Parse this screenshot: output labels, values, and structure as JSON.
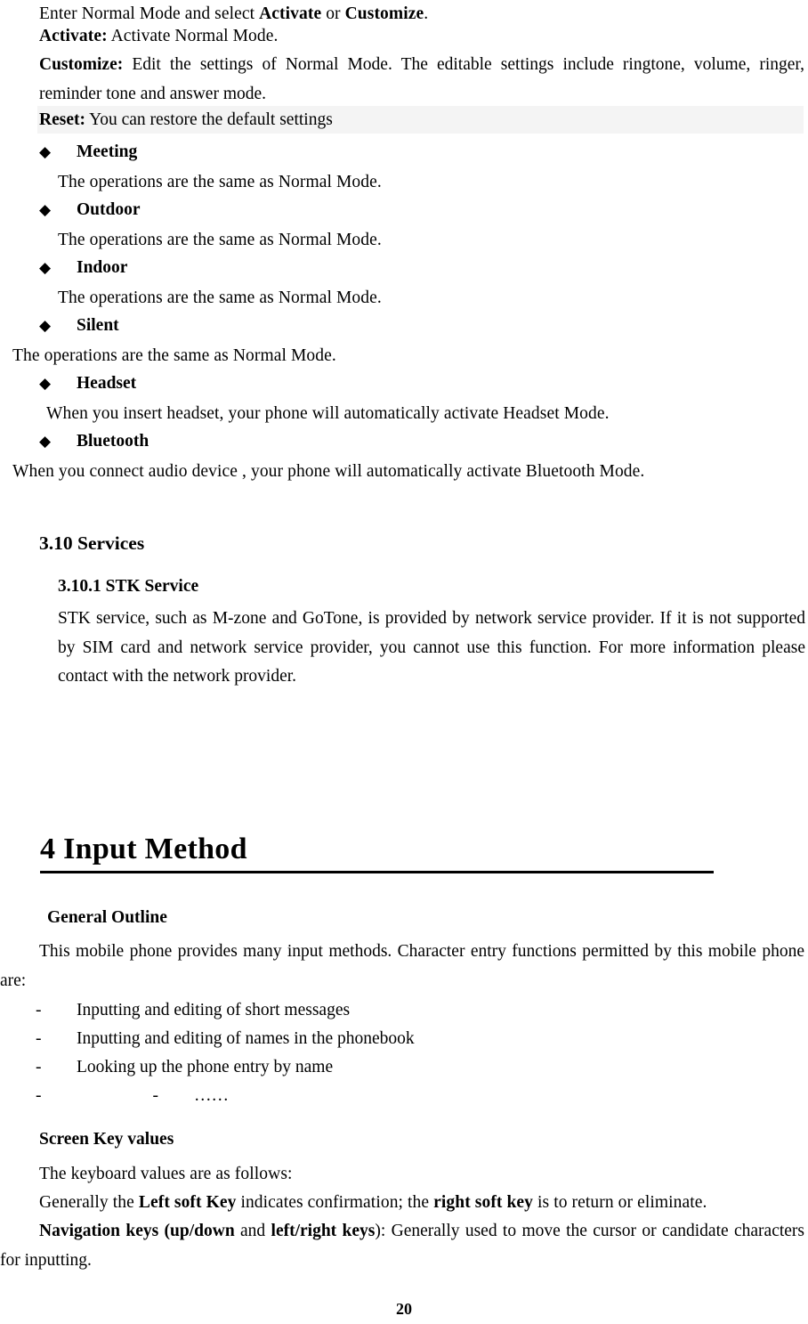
{
  "document": {
    "page_number": "20",
    "bullet_glyph": "◆",
    "dash_glyph": "-",
    "ellipsis_glyph": "……",
    "shade_color": "#f4f4f4",
    "text_color": "#000000"
  },
  "profiles_section": {
    "intro_line": {
      "prefix": "Enter Normal Mode and select ",
      "bold_1": "Activate",
      "middle": " or ",
      "bold_2": "Customize",
      "suffix": "."
    },
    "activate": {
      "label": "Activate:",
      "text": " Activate Normal Mode."
    },
    "customize": {
      "label": "Customize:",
      "text": " Edit the settings of Normal Mode. The editable settings include ringtone, volume, ringer, reminder tone and answer mode."
    },
    "reset": {
      "label": "Reset:",
      "text": " You can restore the default settings"
    },
    "modes": [
      {
        "name": "Meeting",
        "description": "The operations are the same as Normal Mode."
      },
      {
        "name": "Outdoor",
        "description": "The operations are the same as Normal Mode."
      },
      {
        "name": "Indoor",
        "description": "The operations are the same as Normal Mode."
      },
      {
        "name": "Silent",
        "description": "The operations are the same as Normal Mode."
      },
      {
        "name": "Headset",
        "description": "When you insert headset, your phone will automatically activate Headset Mode."
      },
      {
        "name": "Bluetooth",
        "description": "When you connect audio device , your phone will automatically activate Bluetooth Mode."
      }
    ]
  },
  "services_section": {
    "heading": "3.10 Services",
    "subheading": "3.10.1 STK Service",
    "body": "STK service, such as M-zone and GoTone, is provided by network service provider. If it is not supported by SIM card and network service provider, you cannot use this function. For more information please contact with the network provider."
  },
  "input_method_chapter": {
    "title": "4 Input Method",
    "general_outline": {
      "heading": "General Outline",
      "intro": "This mobile phone provides many input methods. Character entry functions permitted by this mobile phone are:",
      "items": [
        "Inputting and editing of short messages",
        "Inputting and editing of names in the phonebook",
        "Looking up the phone entry by name"
      ],
      "last_item_placeholder": "……"
    },
    "screen_key_values": {
      "heading": "Screen Key values",
      "line_1": "The keyboard values are as follows:",
      "line_2": {
        "prefix": "Generally the ",
        "bold_1": "Left soft Key",
        "middle": " indicates confirmation; the ",
        "bold_2": "right soft key",
        "suffix": " is to return or eliminate."
      },
      "line_3": {
        "bold_1": "Navigation keys (",
        "bold_2": "up/down",
        "plain_1": " and ",
        "bold_3": "left/right keys",
        "plain_2": "): Generally used to move the cursor or candidate characters for inputting."
      }
    }
  }
}
